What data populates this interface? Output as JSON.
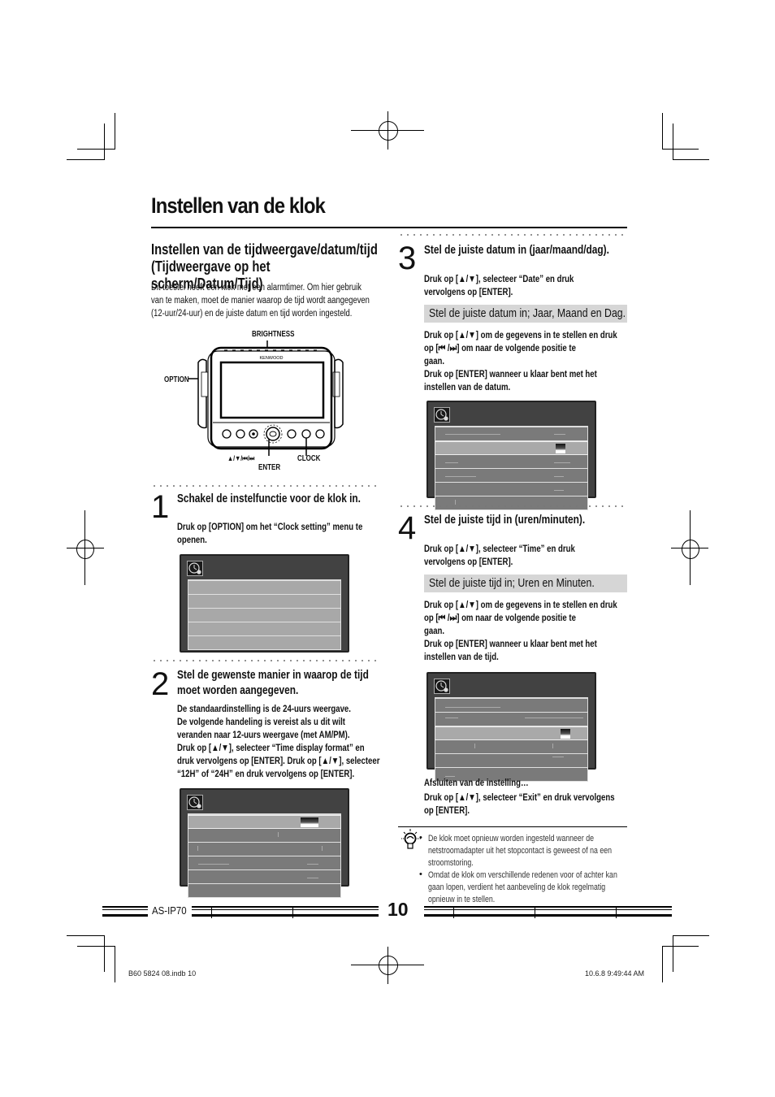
{
  "page": {
    "title": "Instellen van de klok",
    "section_title_line1": "Instellen van de tijdweergave/datum/tijd",
    "section_title_line2": "(Tijdweergave op het scherm/Datum/Tijd)",
    "intro_line1": "Dit toestel heeft een klok met een alarmtimer. Om hier gebruik",
    "intro_line2": "van te maken, moet de manier waarop de tijd wordt aangegeven",
    "intro_line3": "(12-uur/24-uur) en de juiste datum en tijd worden ingesteld."
  },
  "device": {
    "brand": "KENWOOD",
    "labels": {
      "brightness": "BRIGHTNESS",
      "option": "OPTION",
      "nav": "▲/▼/⏮/⏭",
      "enter": "ENTER",
      "clock": "CLOCK"
    }
  },
  "steps": [
    {
      "number": "1",
      "title": "Schakel de instelfunctie voor de klok in.",
      "body_lines": [
        "Druk op [OPTION] om het “Clock setting” menu te",
        "openen."
      ]
    },
    {
      "number": "2",
      "title_line1": "Stel de gewenste manier in waarop de tijd",
      "title_line2": "moet worden aangegeven.",
      "body_lines": [
        "De standaardinstelling is de 24-uurs weergave.",
        "De volgende handeling is vereist als u dit wilt",
        "veranden naar 12-uurs weergave (met AM/PM).",
        "Druk op [▲/▼], selecteer “Time display format” en",
        "druk vervolgens op [ENTER]. Druk op [▲/▼], selecteer",
        "“12H” of “24H” en druk vervolgens op [ENTER]."
      ]
    },
    {
      "number": "3",
      "title": "Stel de juiste datum in (jaar/maand/dag).",
      "body_lines": [
        "Druk op [▲/▼], selecteer “Date” en druk",
        "vervolgens op [ENTER]."
      ],
      "highlight": "Stel de juiste datum in; Jaar, Maand en Dag.",
      "detail_lines": [
        "Druk op [▲/▼] om de gegevens in te stellen en druk",
        "op [⏮ /⏭] om naar de volgende positie te",
        "gaan.",
        "Druk op [ENTER] wanneer u klaar bent met het",
        "instellen van de datum."
      ]
    },
    {
      "number": "4",
      "title": "Stel de juiste tijd in (uren/minuten).",
      "body_lines": [
        "Druk op [▲/▼], selecteer “Time” en druk",
        "vervolgens op [ENTER]."
      ],
      "highlight": "Stel de juiste tijd in; Uren en Minuten.",
      "detail_lines": [
        "Druk op [▲/▼] om de gegevens in te stellen en druk",
        "op [⏮ /⏭] om naar de volgende positie te",
        "gaan.",
        "Druk op [ENTER] wanneer u klaar bent met het",
        "instellen van de tijd."
      ]
    }
  ],
  "exit": {
    "heading": "Afsluiten van de instelling…",
    "line1": "Druk op [▲/▼], selecteer “Exit” en druk vervolgens",
    "line2": "op [ENTER]."
  },
  "tips": [
    {
      "lines": [
        "De klok moet opnieuw worden ingesteld wanneer de",
        "netstroomadapter uit het stopcontact is geweest of na een",
        "stroomstoring."
      ]
    },
    {
      "lines": [
        "Omdat de klok om verschillende redenen voor of achter kan",
        "gaan lopen, verdient het aanbeveling de klok regelmatig",
        "opnieuw in te stellen."
      ]
    }
  ],
  "footer": {
    "model": "AS-IP70",
    "page_number": "10",
    "file_info": "B60 5824 08.indb   10",
    "timestamp": "10.6.8   9:49:44 AM"
  }
}
